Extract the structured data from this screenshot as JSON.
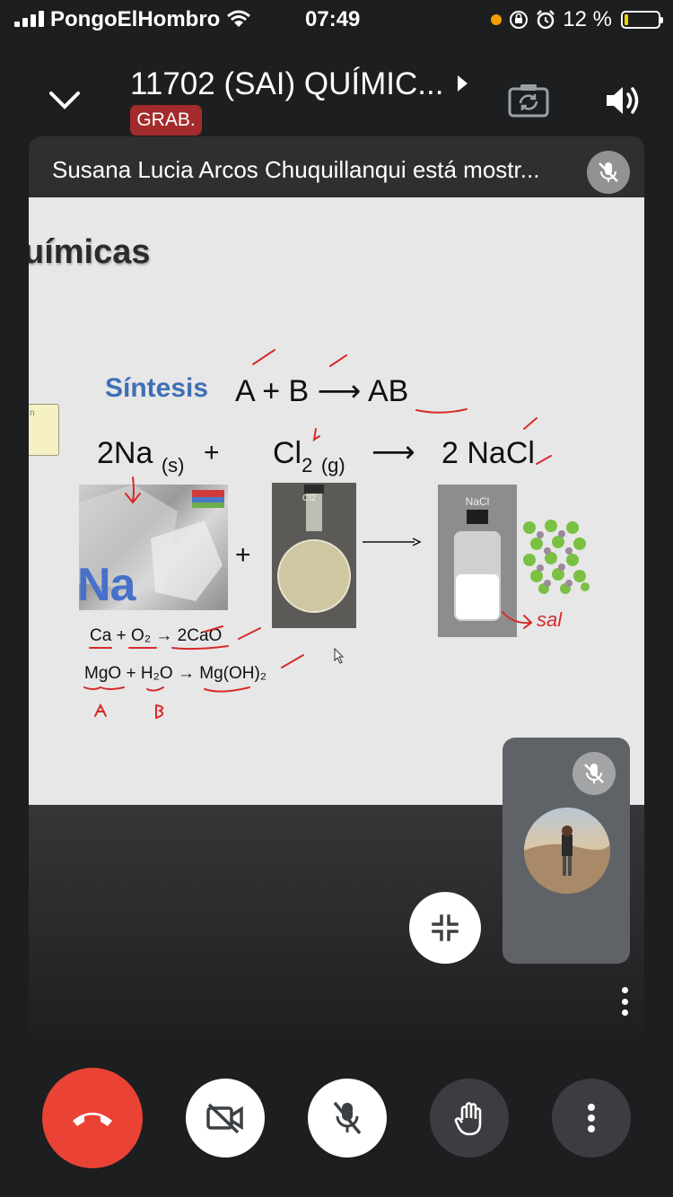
{
  "status_bar": {
    "carrier": "PongoElHombro",
    "time": "07:49",
    "battery_text": "12 %",
    "battery_level": 0.12,
    "colors": {
      "dot": "#f0a000",
      "battery_fill": "#f2d100"
    }
  },
  "header": {
    "meeting_title": "11702 (SAI) QUÍMIC...",
    "recording_badge": "GRAB.",
    "icons": [
      "chevron-down-icon",
      "chevron-right-icon",
      "camera-switch-icon",
      "volume-icon"
    ]
  },
  "presentation": {
    "presenter_caption": "Susana Lucia Arcos Chuquillanqui está mostr...",
    "slide": {
      "title": "uímicas",
      "side_box_text": "n",
      "synthesis_label": "Síntesis",
      "general_equation": "A  + B ⟶ AB",
      "reaction": {
        "reactant1": "2Na",
        "reactant1_state": "(s)",
        "plus": "+",
        "reactant2": "Cl",
        "reactant2_sub": "2",
        "reactant2_state": "(g)",
        "arrow": "⟶",
        "product": "2 NaCl"
      },
      "na_label": "Na",
      "flask_label": "Cl2",
      "nacl_label": "NaCl",
      "example1": "Ca + O₂ → 2CaO",
      "example2": "MgO + H₂O → Mg(OH)₂",
      "annotations": {
        "sal": "sal",
        "a": "A",
        "b": "B"
      }
    }
  },
  "controls": {
    "buttons": [
      "hang-up",
      "camera-off",
      "mic-off",
      "raise-hand",
      "more-options"
    ],
    "colors": {
      "hangup": "#ea4335",
      "white_button": "#ffffff",
      "dark_button": "#3c3d40"
    }
  }
}
